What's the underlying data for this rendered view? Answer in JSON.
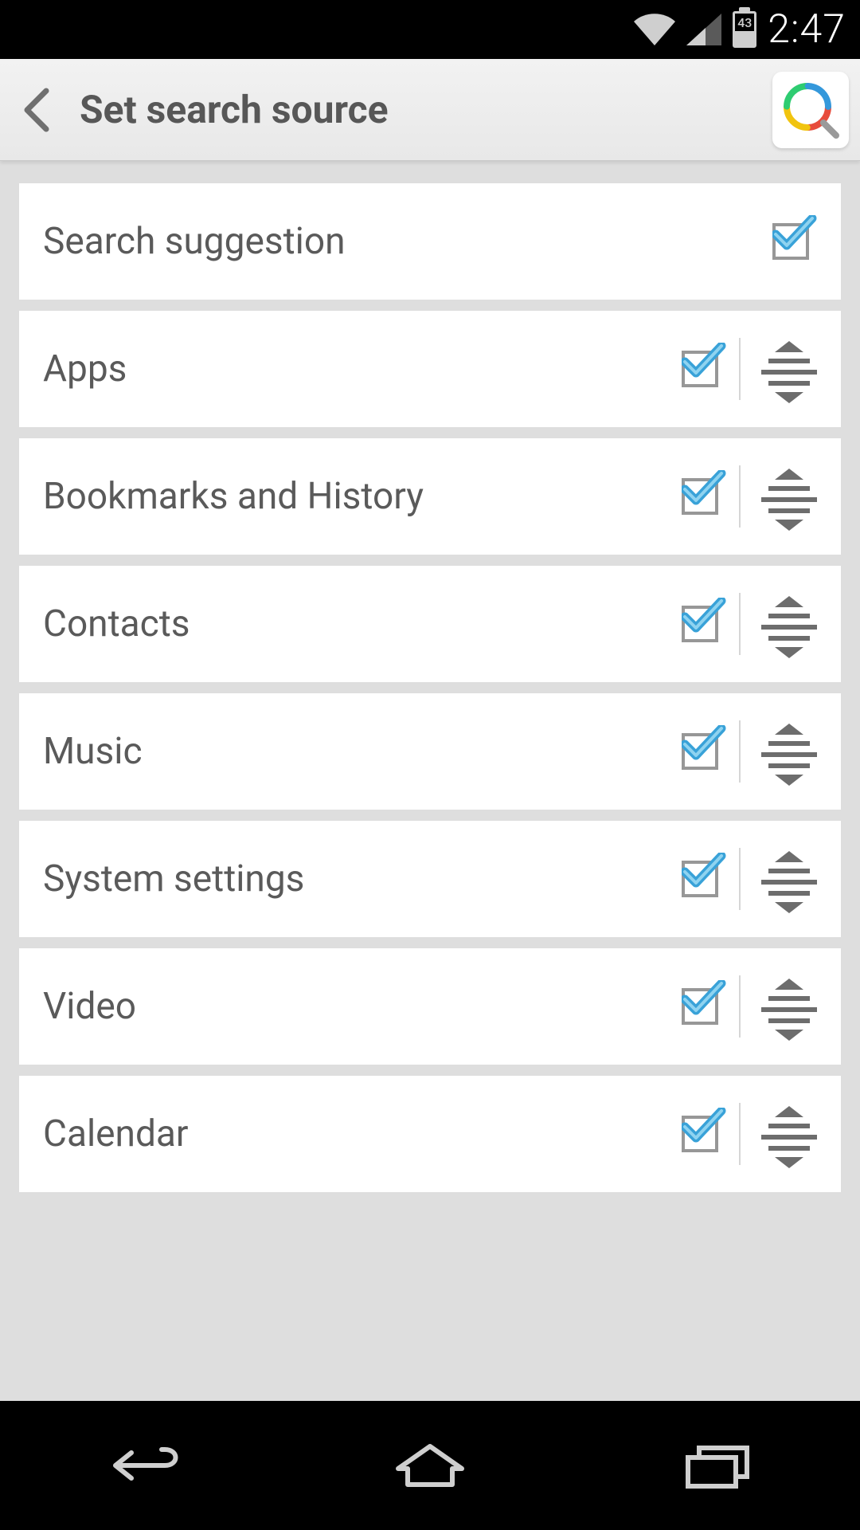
{
  "status": {
    "battery_pct": "43",
    "time": "2:47"
  },
  "header": {
    "title": "Set search source"
  },
  "list": {
    "items": [
      {
        "label": "Search suggestion",
        "checked": true,
        "has_tune": false
      },
      {
        "label": "Apps",
        "checked": true,
        "has_tune": true
      },
      {
        "label": "Bookmarks and History",
        "checked": true,
        "has_tune": true
      },
      {
        "label": "Contacts",
        "checked": true,
        "has_tune": true
      },
      {
        "label": "Music",
        "checked": true,
        "has_tune": true
      },
      {
        "label": "System settings",
        "checked": true,
        "has_tune": true
      },
      {
        "label": "Video",
        "checked": true,
        "has_tune": true
      },
      {
        "label": "Calendar",
        "checked": true,
        "has_tune": true
      }
    ]
  }
}
